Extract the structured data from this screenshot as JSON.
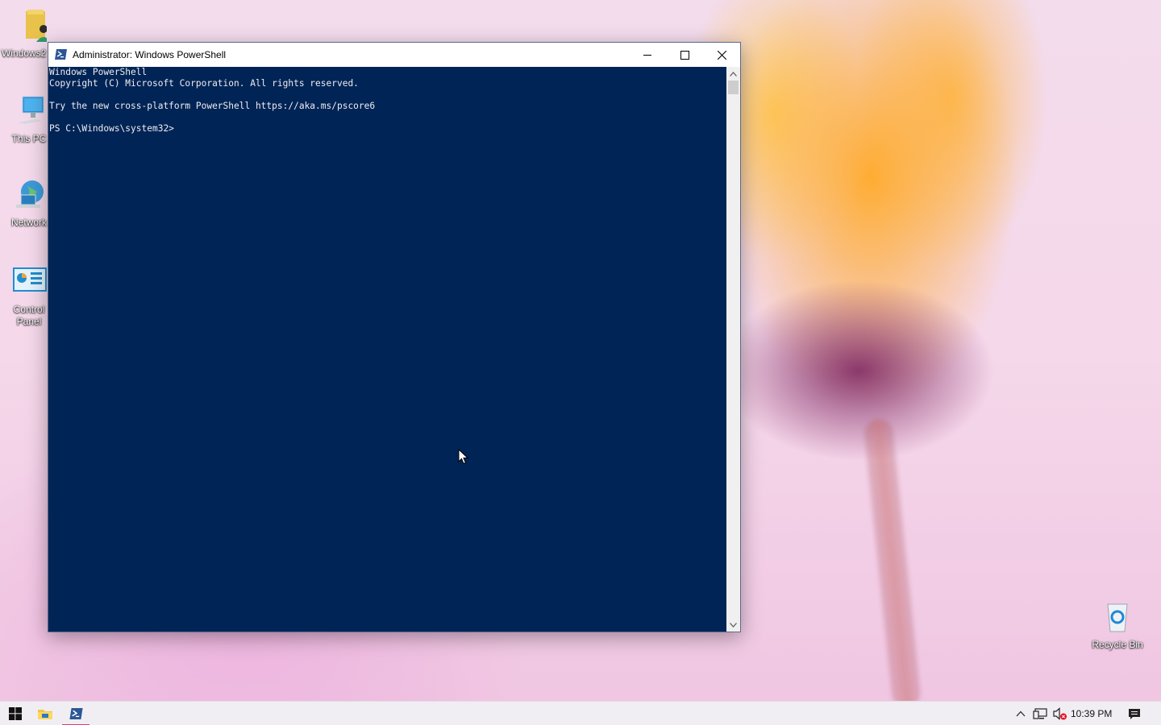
{
  "desktop": {
    "icons": [
      {
        "label": "Windows2"
      },
      {
        "label": "This PC"
      },
      {
        "label": "Network"
      },
      {
        "label": "Control Panel"
      },
      {
        "label": "Recycle Bin"
      }
    ]
  },
  "window": {
    "title": "Administrator: Windows PowerShell",
    "console_lines": [
      "Windows PowerShell",
      "Copyright (C) Microsoft Corporation. All rights reserved.",
      "",
      "Try the new cross-platform PowerShell https://aka.ms/pscore6",
      "",
      "PS C:\\Windows\\system32>"
    ]
  },
  "taskbar": {
    "clock": "10:39 PM",
    "pinned": [
      {
        "name": "start-button",
        "icon": "windows-logo-icon"
      },
      {
        "name": "file-explorer",
        "icon": "folder-icon"
      },
      {
        "name": "powershell",
        "icon": "powershell-icon",
        "active": true
      }
    ],
    "tray": [
      "chevron-up-icon",
      "network-icon",
      "volume-muted-icon",
      "notifications-icon"
    ]
  },
  "colors": {
    "console_bg": "#012456",
    "console_fg": "#eeedf0",
    "accent": "#e0386a"
  }
}
